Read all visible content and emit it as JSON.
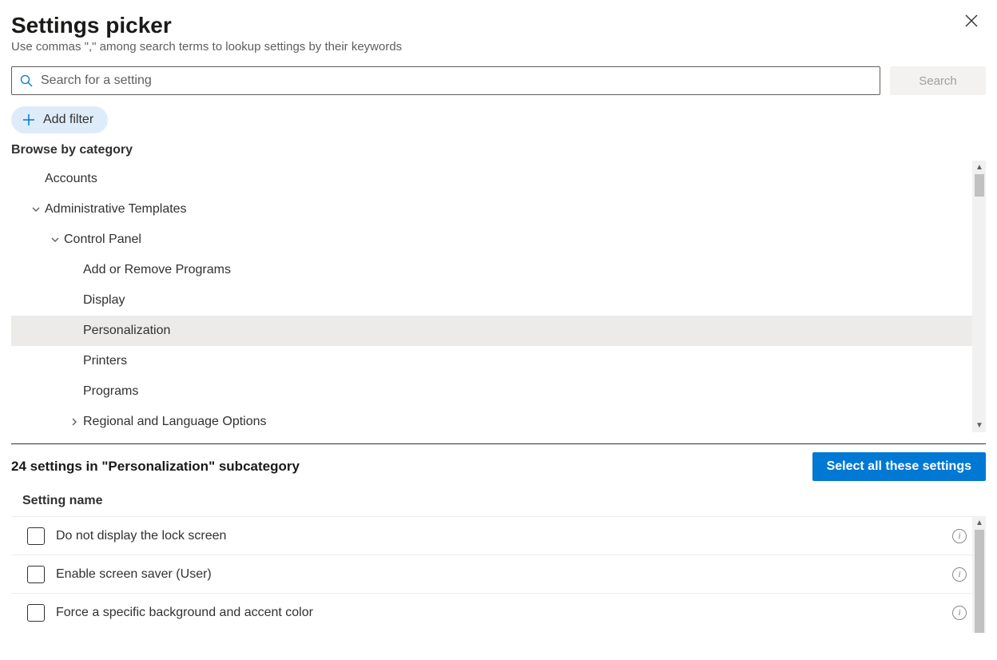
{
  "header": {
    "title": "Settings picker",
    "subtitle": "Use commas \",\" among search terms to lookup settings by their keywords"
  },
  "search": {
    "placeholder": "Search for a setting",
    "button": "Search"
  },
  "filter": {
    "add_label": "Add filter"
  },
  "browse_label": "Browse by category",
  "tree": {
    "accounts": "Accounts",
    "admin_templates": "Administrative Templates",
    "control_panel": "Control Panel",
    "add_remove": "Add or Remove Programs",
    "display": "Display",
    "personalization": "Personalization",
    "printers": "Printers",
    "programs": "Programs",
    "regional": "Regional and Language Options"
  },
  "results": {
    "count_label": "24 settings in \"Personalization\" subcategory",
    "select_all": "Select all these settings",
    "column_header": "Setting name",
    "items": [
      "Do not display the lock screen",
      "Enable screen saver (User)",
      "Force a specific background and accent color"
    ]
  }
}
